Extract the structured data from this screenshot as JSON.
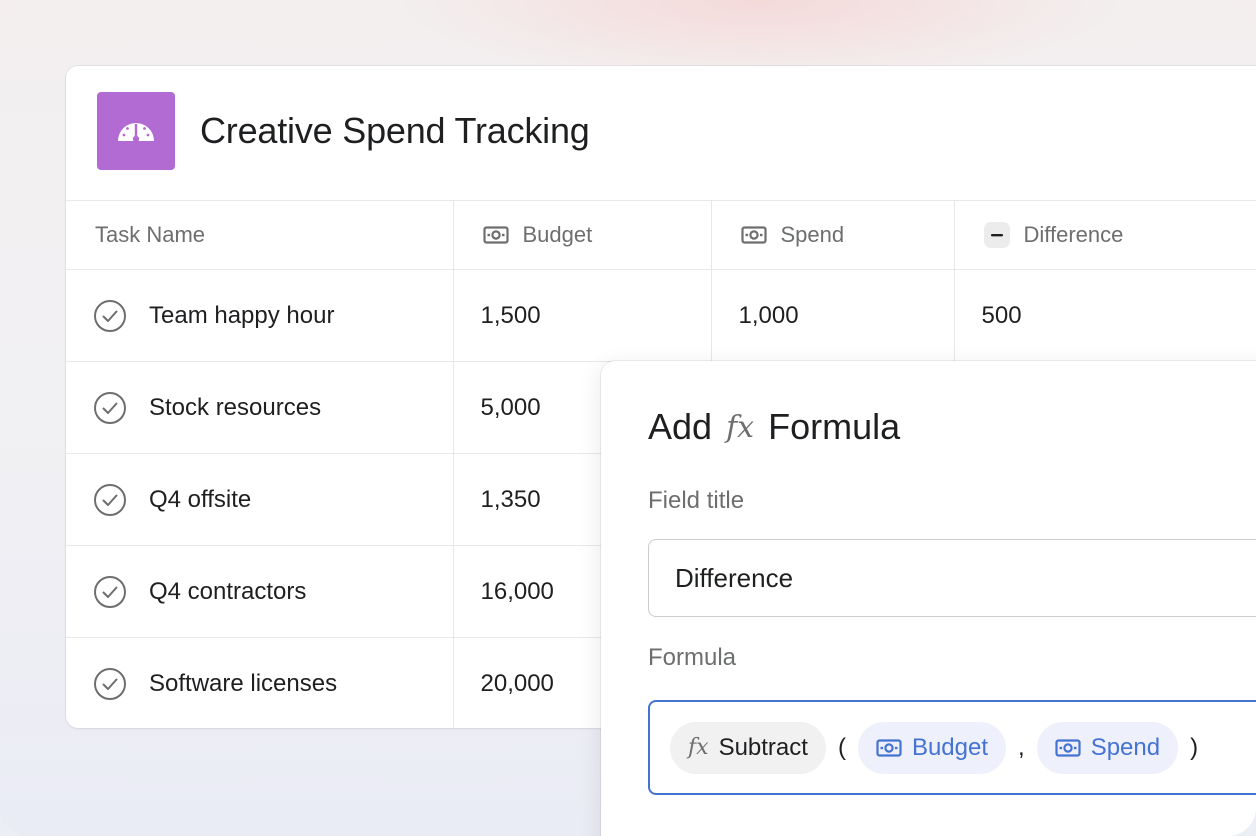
{
  "project": {
    "title": "Creative Spend Tracking",
    "icon": "gauge-icon",
    "icon_color": "#b36bd4"
  },
  "table": {
    "columns": [
      {
        "label": "Task Name",
        "icon": null
      },
      {
        "label": "Budget",
        "icon": "currency-icon"
      },
      {
        "label": "Spend",
        "icon": "currency-icon"
      },
      {
        "label": "Difference",
        "icon": "minus-icon"
      }
    ],
    "rows": [
      {
        "name": "Team happy hour",
        "budget": "1,500",
        "spend": "1,000",
        "difference": "500"
      },
      {
        "name": "Stock resources",
        "budget": "5,000",
        "spend": "",
        "difference": ""
      },
      {
        "name": "Q4 offsite",
        "budget": "1,350",
        "spend": "",
        "difference": ""
      },
      {
        "name": "Q4 contractors",
        "budget": "16,000",
        "spend": "",
        "difference": ""
      },
      {
        "name": "Software licenses",
        "budget": "20,000",
        "spend": "",
        "difference": ""
      }
    ]
  },
  "dialog": {
    "title_prefix": "Add",
    "fx_symbol": "fx",
    "title_suffix": "Formula",
    "field_title_label": "Field title",
    "field_title_value": "Difference",
    "formula_label": "Formula",
    "formula": {
      "function": "Subtract",
      "open_paren": "(",
      "arg1": "Budget",
      "separator": ",",
      "arg2": "Spend",
      "close_paren": ")"
    },
    "accent_color": "#4573d2"
  }
}
